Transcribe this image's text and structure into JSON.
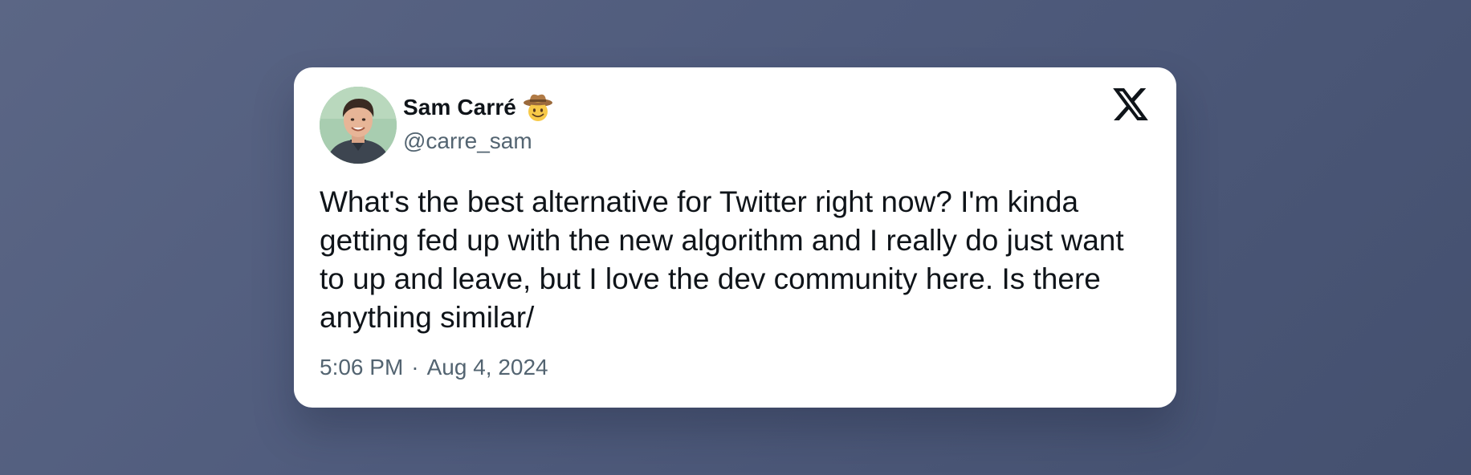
{
  "tweet": {
    "author": {
      "display_name": "Sam Carré",
      "handle": "@carre_sam",
      "badge_emoji": "cowboy-hat-face-icon",
      "avatar": "avatar-photo"
    },
    "platform_icon": "x-logo-icon",
    "text": "What's the best alternative for Twitter right now? I'm kinda getting fed up with the new algorithm and I really do just want to up and leave, but I love the dev community here. Is there anything similar/",
    "time": "5:06 PM",
    "separator": "·",
    "date": "Aug 4, 2024"
  },
  "colors": {
    "background_start": "#5b6685",
    "background_end": "#44506f",
    "card": "#ffffff",
    "text_primary": "#0f1419",
    "text_secondary": "#536471"
  }
}
